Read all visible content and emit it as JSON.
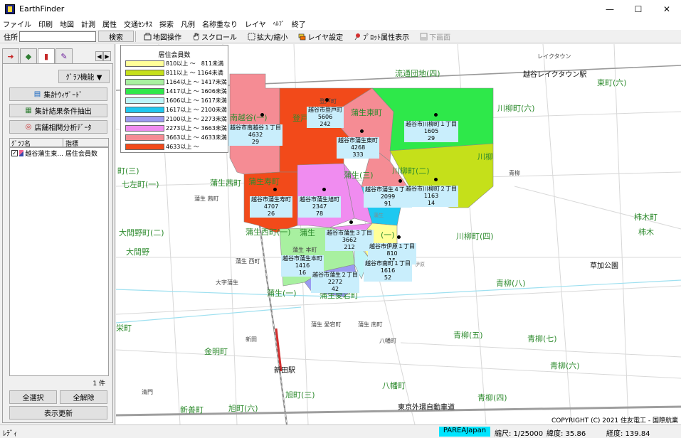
{
  "window": {
    "title": "EarthFinder"
  },
  "menu": [
    "ファイル",
    "印刷",
    "地図",
    "計測",
    "属性",
    "交通ｾﾝｻｽ",
    "探索",
    "凡例",
    "名称重なり",
    "レイヤ",
    "ﾍﾙﾌﾟ",
    "終了"
  ],
  "toolbar": {
    "address_label": "住所",
    "address_value": "",
    "search": "検索",
    "map_op": "地図操作",
    "scroll": "スクロール",
    "zoom": "拡大/縮小",
    "layer_settings": "レイヤ設定",
    "plot_attr": "ﾌﾟﾛｯﾄ属性表示",
    "lower_screen": "下画面"
  },
  "panel": {
    "graph_func": "ｸﾞﾗﾌ機能 ▼",
    "summary_wizard": "集計ｳｨｻﾞｰﾄﾞ",
    "summary_extract": "集計結果条件抽出",
    "store_analysis": "店舗相関分析ﾃﾞｰﾀ",
    "col_graph": "ｸﾞﾗﾌ名",
    "col_index": "指標",
    "row_name": "越谷蒲生東...",
    "row_index": "居住会員数",
    "count": "1 件",
    "select_all": "全選択",
    "deselect_all": "全解除",
    "refresh": "表示更新"
  },
  "legend": {
    "title": "居住会員数",
    "items": [
      {
        "label": "810以上 ～　811未満",
        "color": "#ffff99"
      },
      {
        "label": "811以上 ～ 1164未満",
        "color": "#c5e01a"
      },
      {
        "label": "1164以上 ～ 1417未満",
        "color": "#a8f0a0"
      },
      {
        "label": "1417以上 ～ 1606未満",
        "color": "#2ee84a"
      },
      {
        "label": "1606以上 ～ 1617未満",
        "color": "#bdf4f8"
      },
      {
        "label": "1617以上 ～ 2100未満",
        "color": "#1ec8f0"
      },
      {
        "label": "2100以上 ～ 2273未満",
        "color": "#9b9bf2"
      },
      {
        "label": "2273以上 ～ 3663未満",
        "color": "#f08cf0"
      },
      {
        "label": "3663以上 ～ 4633未満",
        "color": "#f58c94"
      },
      {
        "label": "4633以上 ～",
        "color": "#f24a1a"
      }
    ]
  },
  "plots": [
    {
      "name": "越谷市南越谷１丁目",
      "v1": "4632",
      "v2": "29"
    },
    {
      "name": "越谷市登戸町",
      "v1": "5606",
      "v2": "242"
    },
    {
      "name": "越谷市蒲生東町",
      "v1": "4268",
      "v2": "333"
    },
    {
      "name": "越谷市川柳町１丁目",
      "v1": "1605",
      "v2": "29"
    },
    {
      "name": "越谷市蒲生寿町",
      "v1": "4707",
      "v2": "26"
    },
    {
      "name": "越谷市蒲生旭町",
      "v1": "2347",
      "v2": "78"
    },
    {
      "name": "越谷市蒲生４丁目",
      "v1": "2099",
      "v2": "91"
    },
    {
      "name": "越谷市川柳町２丁目",
      "v1": "1163",
      "v2": "14"
    },
    {
      "name": "越谷市蒲生３丁目",
      "v1": "3662",
      "v2": "212"
    },
    {
      "name": "越谷市伊原１丁目",
      "v1": "810",
      "v2": "15"
    },
    {
      "name": "越谷市蒲生本町",
      "v1": "1416",
      "v2": "16"
    },
    {
      "name": "越谷市南町１丁目",
      "v1": "1616",
      "v2": "52"
    },
    {
      "name": "越谷市蒲生２丁目",
      "v1": "2272",
      "v2": "42"
    }
  ],
  "places": {
    "p1": "流通団地(四)",
    "p2": "越谷レイクタウン駅",
    "p3": "東町(六)",
    "p4": "川柳町(六)",
    "p5": "南越谷(一)",
    "p6": "登戸",
    "p7": "蒲生東町",
    "p8": "登戸町",
    "p9": "川柳",
    "p10": "蒲生(三)",
    "p11": "川柳町(二)",
    "p12": "町(三)",
    "p13": "七左町(一)",
    "p14": "蒲生茜町",
    "p15": "蒲生寿町",
    "p16": "大間野町(二)",
    "p17": "蒲生西町(一)",
    "p18": "蒲生",
    "p19": "大間野",
    "p20": "川柳町(四)",
    "p21": "柿木町",
    "p22": "柿木",
    "p23": "草加公園",
    "p24": "青柳(八)",
    "p25": "蒲生(一)",
    "p26": "栄町",
    "p27": "青柳(五)",
    "p28": "青柳(七)",
    "p29": "金明町",
    "p30": "新田駅",
    "p31": "八幡町",
    "p32": "青柳(六)",
    "p33": "旭町(三)",
    "p34": "青柳(四)",
    "p35": "東京外環自動車道",
    "p36": "新善町",
    "p37": "旭町(六)",
    "p38": "レイクタウン",
    "p39": "蒲生 西町",
    "p40": "蒲生 本町",
    "p41": "大字蒲生",
    "p42": "蒲生 愛宕町",
    "p43": "蒲生 南町",
    "p44": "新田",
    "p45": "八幡町",
    "p46": "蒲生 茜町",
    "p47": "青柳",
    "p48": "清門",
    "p49": "蒲生",
    "p50": "(一)",
    "p51": "蒲生愛宕町",
    "p52": "伊原"
  },
  "copyright": "COPYRIGHT (C) 2021 住友電工 - 国際航業",
  "status": {
    "ready": "ﾚﾃﾞｨ",
    "area": "PAREAJapan",
    "scale": "縮尺: 1/25000",
    "lat": "緯度: 35.86",
    "lon": "経度: 139.84"
  }
}
